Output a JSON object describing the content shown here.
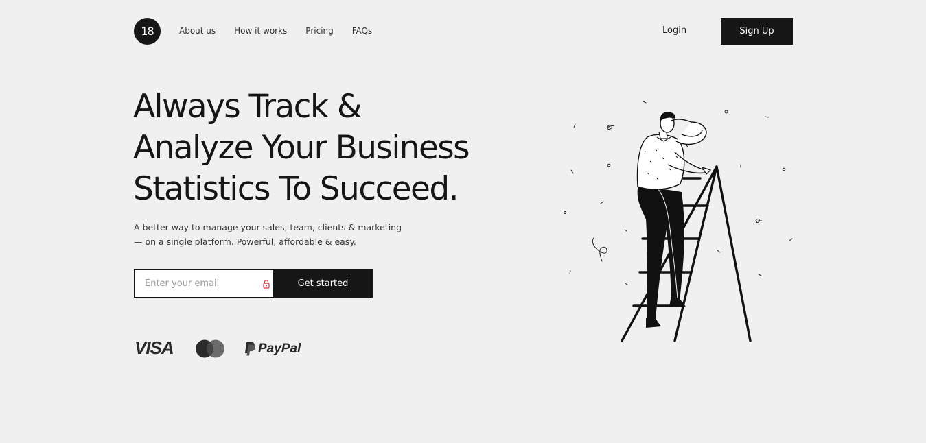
{
  "header": {
    "logo_text": "18",
    "nav": [
      "About us",
      "How it works",
      "Pricing",
      "FAQs"
    ],
    "login_label": "Login",
    "signup_label": "Sign Up"
  },
  "hero": {
    "title_lines": [
      "Always Track &",
      "Analyze Your Business",
      "Statistics To Succeed."
    ],
    "subtitle_lines": [
      "A better way to manage your sales, team, clients & marketing",
      "— on a single platform. Powerful, affordable & easy."
    ],
    "email_placeholder": "Enter your email",
    "cta_label": "Get started"
  },
  "payments": {
    "visa": "VISA",
    "mastercard_icon": "mastercard-icon",
    "paypal": "PayPal"
  },
  "illustration": {
    "icon": "man-on-ladder-illustration"
  },
  "colors": {
    "dark": "#161616",
    "background": "#f0f0f0",
    "lock_accent": "#e0303a"
  }
}
